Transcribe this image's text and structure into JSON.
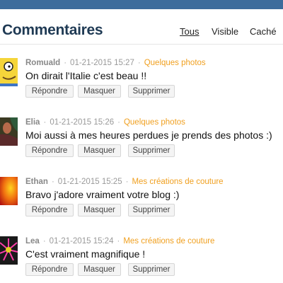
{
  "header": {
    "title": "Commentaires",
    "filters": {
      "all": "Tous",
      "visible": "Visible",
      "hidden": "Caché"
    }
  },
  "actions": {
    "reply": "Répondre",
    "hide": "Masquer",
    "delete": "Supprimer"
  },
  "comments": [
    {
      "author": "Romuald",
      "date": "01-21-2015 15:27",
      "post": "Quelques photos",
      "text": "On dirait l'Italie c'est beau !!",
      "avatar": "cartoon-character-avatar"
    },
    {
      "author": "Elia",
      "date": "01-21-2015 15:26",
      "post": "Quelques photos",
      "text": "Moi aussi à mes heures perdues je prends des photos :)",
      "avatar": "portrait-painting-avatar"
    },
    {
      "author": "Ethan",
      "date": "01-21-2015 15:25",
      "post": "Mes créations de couture",
      "text": "Bravo j'adore vraiment votre blog :)",
      "avatar": "orange-red-abstract-avatar"
    },
    {
      "author": "Lea",
      "date": "01-21-2015 15:24",
      "post": "Mes créations de couture",
      "text": "C'est vraiment magnifique !",
      "avatar": "pink-flower-avatar"
    }
  ],
  "colors": {
    "topbar": "#3d6c9c",
    "title": "#1f3a54",
    "post_link": "#f0a020"
  }
}
